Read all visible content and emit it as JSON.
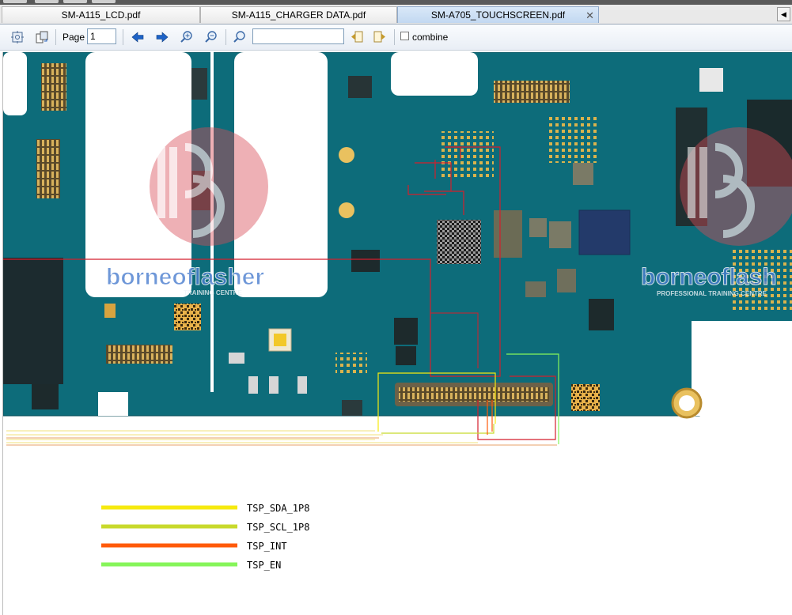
{
  "tabs": [
    {
      "label": "SM-A115_LCD.pdf"
    },
    {
      "label": "SM-A115_CHARGER DATA.pdf"
    },
    {
      "label": "SM-A705_TOUCHSCREEN.pdf",
      "active": true
    }
  ],
  "toolbar": {
    "page_label": "Page",
    "page_value": "1",
    "search_value": "",
    "combine_label": "combine",
    "combine_checked": false
  },
  "document": {
    "watermark_left_text": "borneoflasher",
    "watermark_left_sub": "TRAINING CENTRE",
    "watermark_right_text": "borneoflash",
    "watermark_right_sub": "PROFESSIONAL TRAINING CENTRE",
    "legend": [
      {
        "label": "TSP_SDA_1P8",
        "color": "#f6ea0f"
      },
      {
        "label": "TSP_SCL_1P8",
        "color": "#c8d92c"
      },
      {
        "label": "TSP_INT",
        "color": "#ff5a0a"
      },
      {
        "label": "TSP_EN",
        "color": "#86f55a"
      }
    ]
  },
  "colors": {
    "board": "#0d6c7a",
    "board_dark": "#0b5562",
    "trace_red": "#d41f2c",
    "brand_blue": "#4a7ecf"
  }
}
